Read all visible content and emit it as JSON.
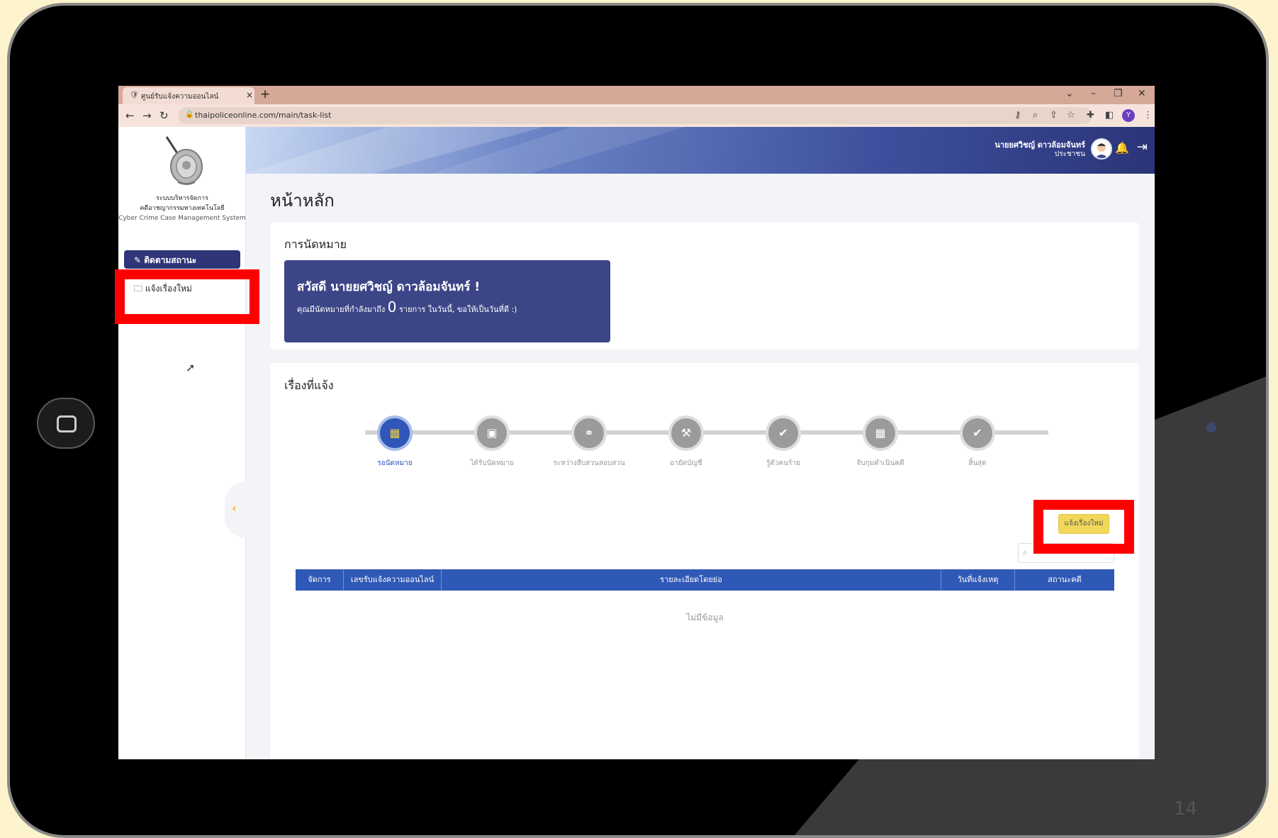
{
  "browser": {
    "tab_title": "ศูนย์รับแจ้งความออนไลน์",
    "tab_close": "×",
    "new_tab": "+",
    "url": "thaipoliceonline.com/main/task-list",
    "profile_initial": "Y",
    "window_controls": {
      "minimize_collapse": "⌄",
      "minimize": "–",
      "restore": "❐",
      "close": "✕"
    }
  },
  "sidebar": {
    "logo_line1": "ระบบบริหารจัดการ",
    "logo_line2": "คดีอาชญากรรมทางเทคโนโลยี",
    "logo_line3": "Cyber Crime Case Management System",
    "items": [
      {
        "label": "ติดตามสถานะ",
        "icon": "edit-icon",
        "active": true
      },
      {
        "label": "แจ้งเรื่องใหม่",
        "icon": "folder-plus-icon",
        "active": false
      }
    ],
    "collapse_symbol": "‹"
  },
  "header": {
    "user_name": "นายยศวิชญ์ ดาวล้อมจันทร์",
    "user_role": "ประชาชน"
  },
  "page": {
    "title": "หน้าหลัก"
  },
  "appointments": {
    "title": "การนัดหมาย",
    "greeting": "สวัสดี นายยศวิชญ์ ดาวล้อมจันทร์ !",
    "message_prefix": "คุณมีนัดหมายที่กำลังมาถึง",
    "count": "0",
    "message_suffix": "รายการ ในวันนี้, ขอให้เป็นวันที่ดี :)"
  },
  "reports": {
    "title": "เรื่องที่แจ้ง",
    "steps": [
      {
        "label": "รอนัดหมาย",
        "icon": "calendar-icon",
        "active": true
      },
      {
        "label": "ได้รับนัดหมาย",
        "icon": "briefcase-icon",
        "active": false
      },
      {
        "label": "ระหว่างสืบสวนสอบสวน",
        "icon": "handshake-icon",
        "active": false
      },
      {
        "label": "อายัดบัญชี",
        "icon": "gavel-icon",
        "active": false
      },
      {
        "label": "รู้ตัวคนร้าย",
        "icon": "check-circle-icon",
        "active": false
      },
      {
        "label": "จับกุมดำเนินคดี",
        "icon": "calendar-icon",
        "active": false
      },
      {
        "label": "สิ้นสุด",
        "icon": "check-circle-icon",
        "active": false
      }
    ],
    "new_report_button": "แจ้งเรื่องใหม่",
    "table_headers": [
      "จัดการ",
      "เลขรับแจ้งความออนไลน์",
      "รายละเอียดโดยย่อ",
      "วันที่แจ้งเหตุ",
      "สถานะคดี"
    ],
    "empty_text": "ไม่มีข้อมูล"
  },
  "slide_number": "14",
  "colors": {
    "highlight": "#ff0000",
    "primary": "#2f59b6",
    "sidebar_active": "#2f3577",
    "button_yellow": "#f2d85a"
  }
}
